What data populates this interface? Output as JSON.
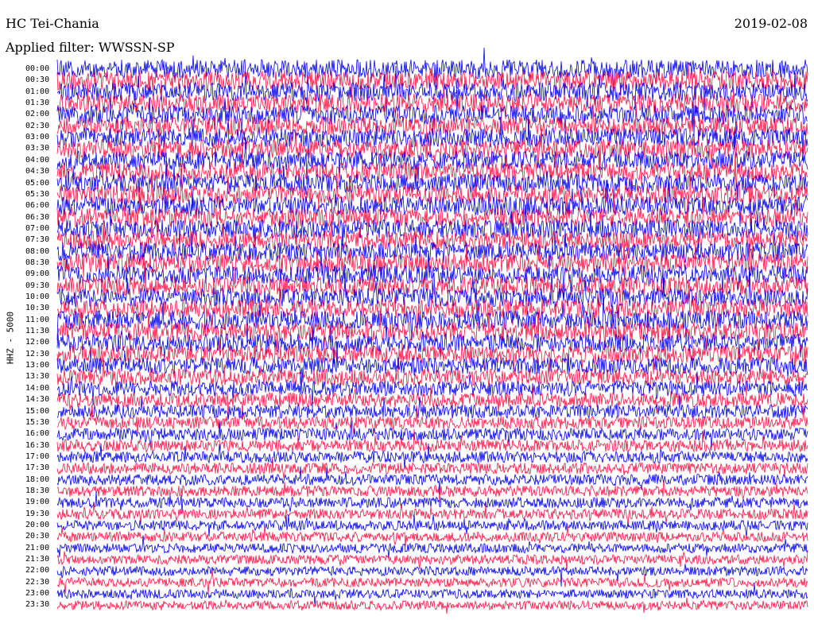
{
  "header": {
    "station": "HC Tei-Chania",
    "date": "2019-02-08",
    "filter": "Applied filter: WWSSN-SP"
  },
  "channel_label": "HHZ - 5000",
  "colors": {
    "trace_a": "#0000ee",
    "trace_b": "#ff1144",
    "background": "#ffffff",
    "text": "#000000"
  },
  "chart_data": {
    "type": "line",
    "title": "HC Tei-Chania",
    "subtitle": "Applied filter: WWSSN-SP",
    "date": "2019-02-08",
    "ylabel": "HHZ - 5000",
    "row_labels": [
      "00:00",
      "00:30",
      "01:00",
      "01:30",
      "02:00",
      "02:30",
      "03:00",
      "03:30",
      "04:00",
      "04:30",
      "05:00",
      "05:30",
      "06:00",
      "06:30",
      "07:00",
      "07:30",
      "08:00",
      "08:30",
      "09:00",
      "09:30",
      "10:00",
      "10:30",
      "11:00",
      "11:30",
      "12:00",
      "12:30",
      "13:00",
      "13:30",
      "14:00",
      "14:30",
      "15:00",
      "15:30",
      "16:00",
      "16:30",
      "17:00",
      "17:30",
      "18:00",
      "18:30",
      "19:00",
      "19:30",
      "20:00",
      "20:30",
      "21:00",
      "21:30",
      "22:00",
      "22:30",
      "23:00",
      "23:30"
    ],
    "series": [
      {
        "color": "#0000ee",
        "rows": "even"
      },
      {
        "color": "#ff1144",
        "rows": "odd"
      }
    ],
    "relative_noise_amplitude": [
      1.0,
      1.0,
      1.0,
      1.0,
      1.0,
      1.0,
      1.0,
      1.0,
      1.0,
      1.0,
      1.0,
      1.0,
      1.0,
      1.0,
      1.0,
      1.0,
      1.0,
      1.0,
      1.0,
      1.0,
      1.0,
      1.0,
      1.0,
      1.0,
      0.95,
      0.9,
      0.85,
      0.8,
      0.72,
      0.65,
      0.58,
      0.52,
      0.48,
      0.45,
      0.42,
      0.4,
      0.38,
      0.36,
      0.34,
      0.32,
      0.3,
      0.28,
      0.26,
      0.25,
      0.24,
      0.23,
      0.22,
      0.21
    ],
    "grid": false,
    "legend": "none"
  }
}
